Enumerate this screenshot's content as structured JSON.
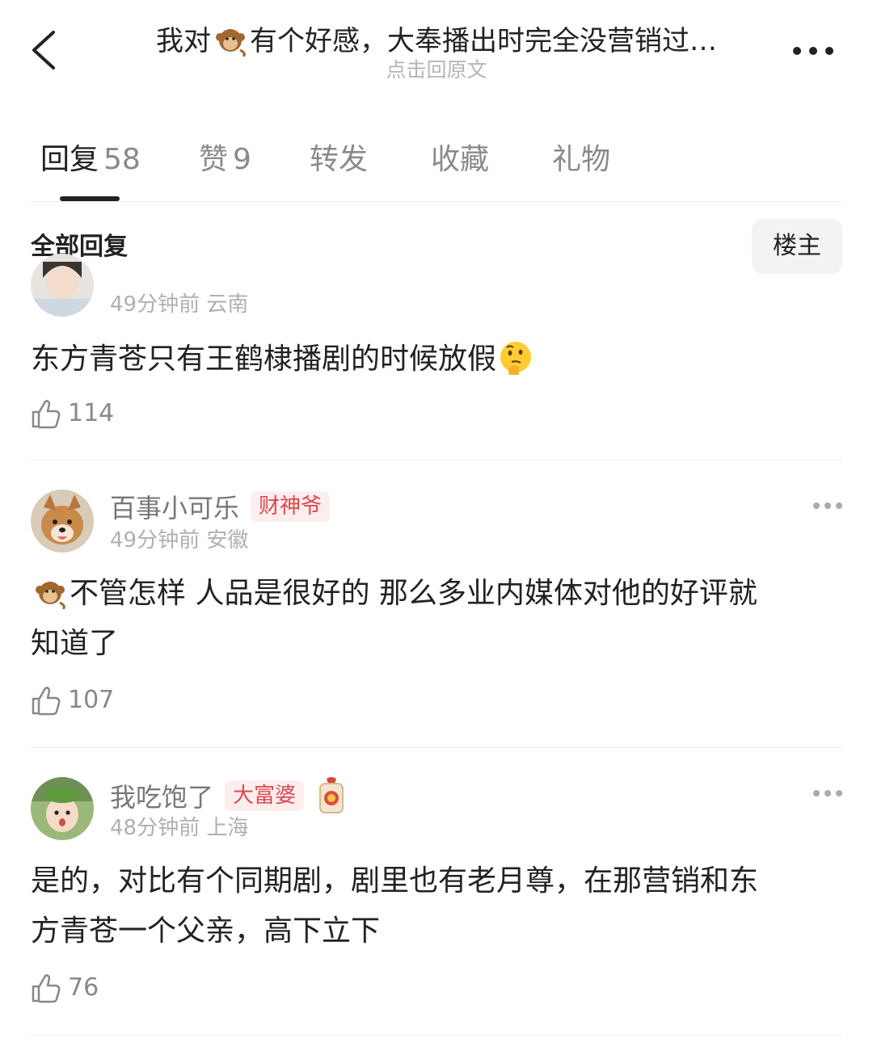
{
  "header": {
    "title_prefix": "我对",
    "title_suffix": "有个好感，大奉播出时完全没营销过…",
    "title_emoji": "monkey-emoji",
    "subtitle": "点击回原文"
  },
  "tabs": [
    {
      "label": "回复",
      "count": "58",
      "active": true
    },
    {
      "label": "赞",
      "count": "9",
      "active": false
    },
    {
      "label": "转发",
      "count": "",
      "active": false
    },
    {
      "label": "收藏",
      "count": "",
      "active": false
    },
    {
      "label": "礼物",
      "count": "",
      "active": false
    }
  ],
  "filter": {
    "all_label": "全部回复",
    "owner_label": "楼主"
  },
  "comments": [
    {
      "name": "",
      "badge": "",
      "meta": "49分钟前 云南",
      "text": "东方青苍只有王鹤棣播剧的时候放假",
      "trailing_emoji": "thinking-face-emoji",
      "likes": "114"
    },
    {
      "name": "百事小可乐",
      "badge": "财神爷",
      "meta": "49分钟前 安徽",
      "leading_emoji": "monkey-emoji",
      "text_line1": "不管怎样 人品是很好的 那么多业内媒体对他的好评就",
      "text_line2": "知道了",
      "likes": "107"
    },
    {
      "name": "我吃饱了",
      "badge": "大富婆",
      "badge_icon": "lucky-pouch-icon",
      "meta": "48分钟前 上海",
      "text_line1": "是的，对比有个同期剧，剧里也有老月尊，在那营销和东",
      "text_line2": "方青苍一个父亲，高下立下",
      "likes": "76"
    }
  ],
  "colors": {
    "accent_badge": "#e0484f",
    "badge_bg": "#fdeeee",
    "muted": "#b0b0b0"
  }
}
